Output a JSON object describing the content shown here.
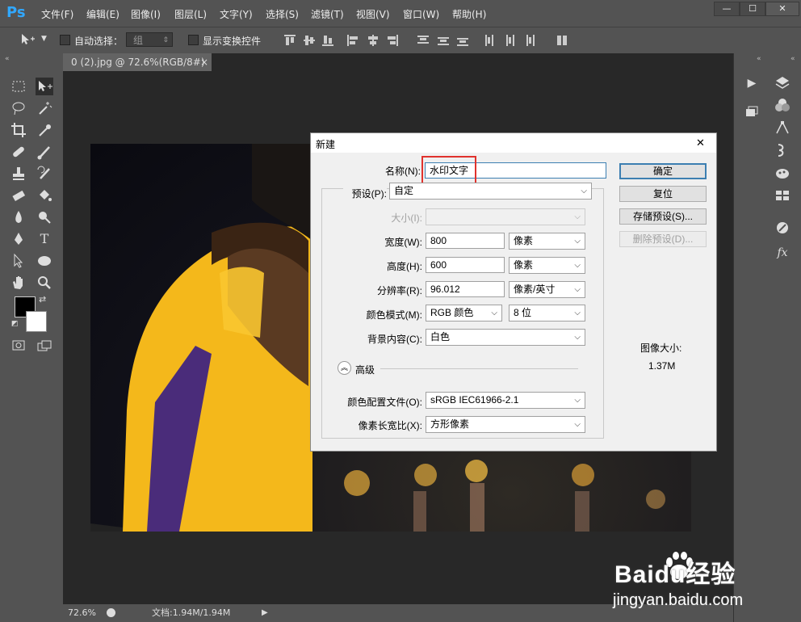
{
  "app": {
    "logo": "Ps"
  },
  "menubar": {
    "items": [
      "文件(F)",
      "编辑(E)",
      "图像(I)",
      "图层(L)",
      "文字(Y)",
      "选择(S)",
      "滤镜(T)",
      "视图(V)",
      "窗口(W)",
      "帮助(H)"
    ],
    "window_buttons": [
      "—",
      "☐",
      "✕"
    ]
  },
  "options_bar": {
    "auto_select_label": "自动选择：",
    "auto_select_value": "组",
    "show_transform_label": "显示变换控件"
  },
  "document": {
    "tab_title": "0 (2).jpg @ 72.6%(RGB/8#) *",
    "tab_close": "×"
  },
  "status_bar": {
    "zoom": "72.6%",
    "doc_info": "文档:1.94M/1.94M"
  },
  "dialog": {
    "title": "新建",
    "close": "✕",
    "name_label": "名称(N):",
    "name_value": "水印文字",
    "preset_label": "预设(P):",
    "preset_value": "自定",
    "size_label": "大小(I):",
    "width_label": "宽度(W):",
    "width_value": "800",
    "width_unit": "像素",
    "height_label": "高度(H):",
    "height_value": "600",
    "height_unit": "像素",
    "resolution_label": "分辨率(R):",
    "resolution_value": "96.012",
    "resolution_unit": "像素/英寸",
    "colormode_label": "颜色模式(M):",
    "colormode_value": "RGB 颜色",
    "bitdepth_value": "8 位",
    "background_label": "背景内容(C):",
    "background_value": "白色",
    "advanced_label": "高级",
    "profile_label": "颜色配置文件(O):",
    "profile_value": "sRGB IEC61966-2.1",
    "aspect_label": "像素长宽比(X):",
    "aspect_value": "方形像素",
    "ok_button": "确定",
    "reset_button": "复位",
    "save_preset_button": "存储预设(S)...",
    "delete_preset_button": "删除预设(D)...",
    "image_size_label": "图像大小:",
    "image_size_value": "1.37M"
  },
  "watermark": {
    "brand": "Baidu经验",
    "url": "jingyan.baidu.com"
  },
  "colors": {
    "highlight_box": "#e0322d",
    "focused_border": "#3c7fb1",
    "default_button_border": "#3c7fb1"
  }
}
